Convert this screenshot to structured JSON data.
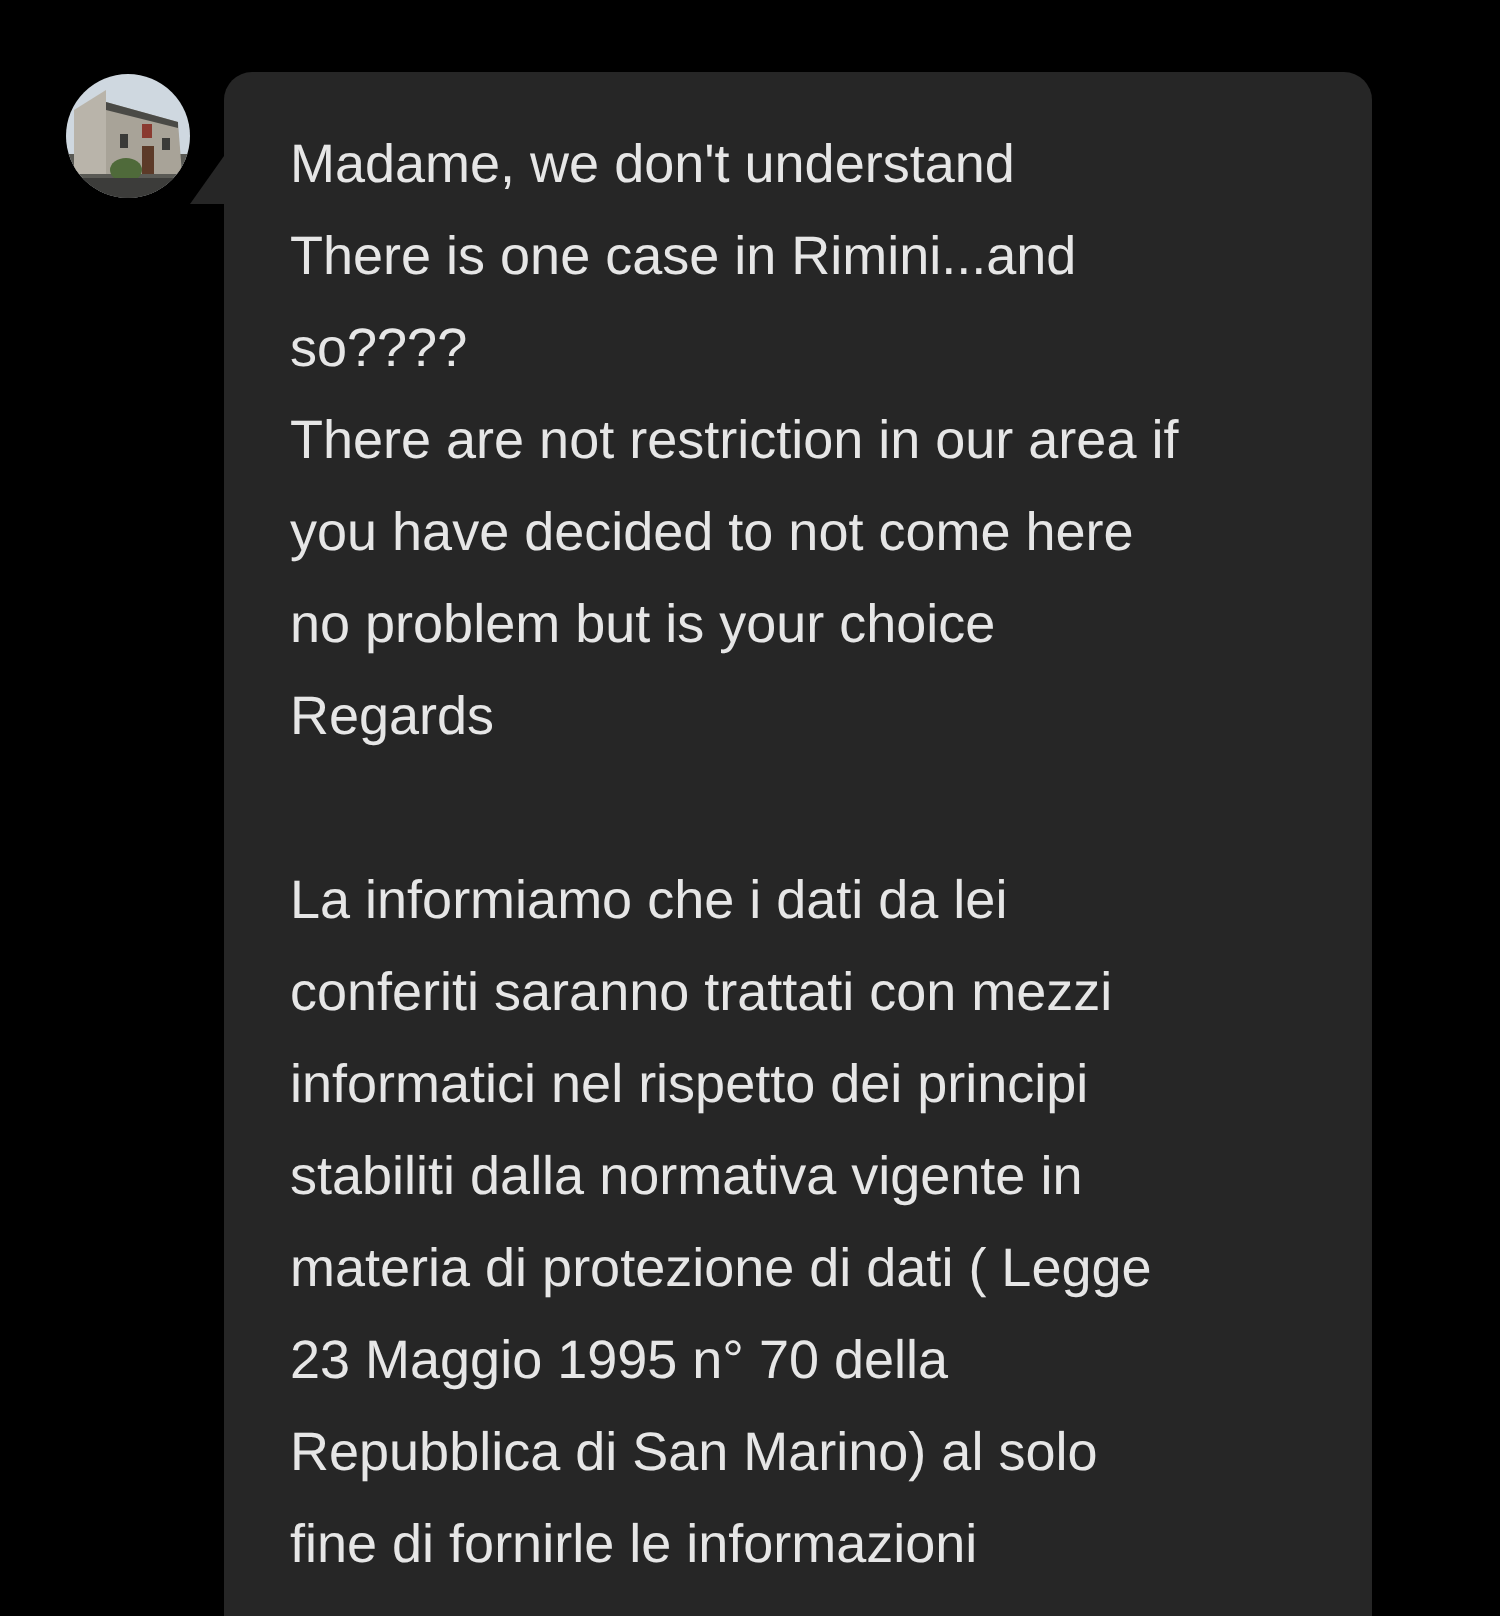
{
  "message": {
    "paragraphs": [
      [
        "Madame, we don't understand",
        "There is one case in Rimini...and",
        "so????",
        "There are not restriction in our area if",
        "you have decided to not come here",
        "no problem but is your choice",
        "Regards"
      ],
      [
        "La informiamo che i dati da lei",
        "conferiti saranno trattati con mezzi",
        "informatici nel rispetto dei principi",
        "stabiliti dalla normativa vigente in",
        "materia di protezione di dati ( Legge",
        "23 Maggio 1995 n° 70 della",
        "Repubblica di San Marino) al solo",
        "fine di fornirle le informazioni"
      ]
    ]
  }
}
